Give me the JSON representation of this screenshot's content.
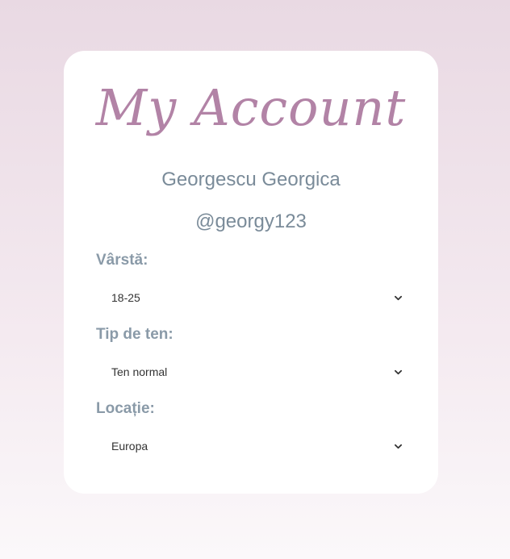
{
  "page": {
    "title": "My Account",
    "full_name": "Georgescu Georgica",
    "username": "@georgy123"
  },
  "fields": [
    {
      "label": "Vârstă:",
      "value": "18-25"
    },
    {
      "label": "Tip de ten:",
      "value": "Ten normal"
    },
    {
      "label": "Locație:",
      "value": "Europa"
    }
  ],
  "colors": {
    "accent": "#b283a6",
    "text_muted": "#7a8b99",
    "label": "#8a9aa8"
  },
  "icons": {
    "dropdown": "chevron-down-icon"
  }
}
